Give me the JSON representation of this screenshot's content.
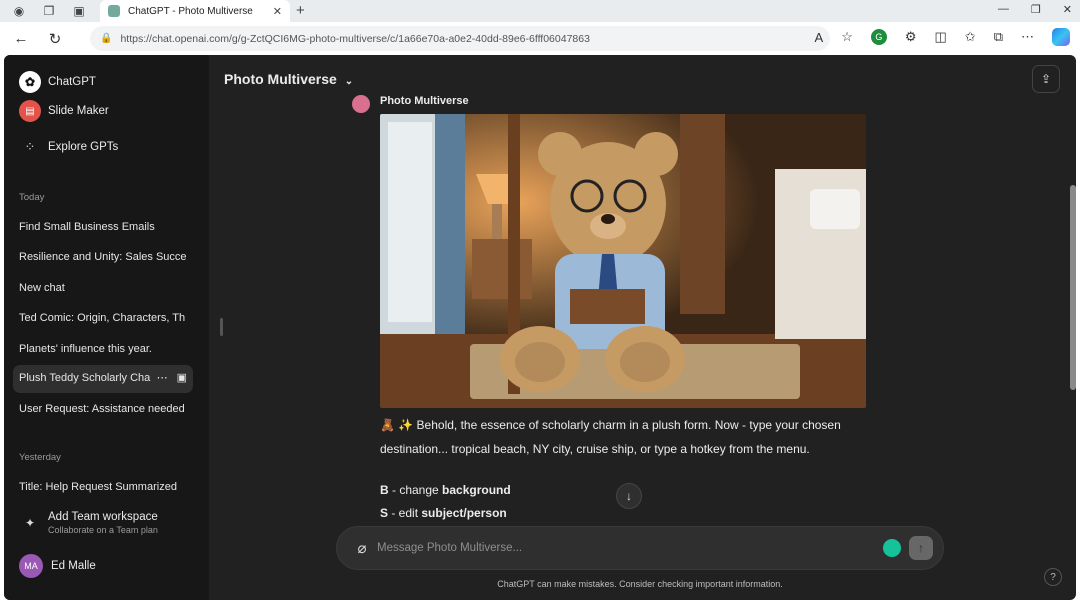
{
  "browser": {
    "tab_title": "ChatGPT - Photo Multiverse",
    "tab_close": "✕",
    "new_tab": "+",
    "url": "https://chat.openai.com/g/g-ZctQCI6MG-photo-multiverse/c/1a66e70a-a0e2-40dd-89e6-6fff06047863"
  },
  "sidebar": {
    "top_items": [
      {
        "label": "ChatGPT",
        "icon": "chatgpt-logo-icon"
      },
      {
        "label": "Slide Maker",
        "icon": "slide-maker-icon"
      },
      {
        "label": "Explore GPTs",
        "icon": "grid-icon"
      }
    ],
    "today_label": "Today",
    "today_chats": [
      "Find Small Business Emails",
      "Resilience and Unity: Sales Succe",
      "New chat",
      "Ted Comic: Origin, Characters, Th",
      "Planets' influence this year.",
      "Plush Teddy Scholarly Cha",
      "User Request: Assistance needed"
    ],
    "yesterday_label": "Yesterday",
    "yesterday_chats": [
      "Title: Help Request Summarized"
    ],
    "team": {
      "title": "Add Team workspace",
      "subtitle": "Collaborate on a Team plan"
    },
    "user": {
      "initials": "MA",
      "name": "Ed Malle"
    }
  },
  "main": {
    "title": "Photo Multiverse",
    "message": {
      "author": "Photo Multiverse",
      "line1": "🧸 ✨ Behold, the essence of scholarly charm in a plush form. Now - type your chosen",
      "line2": "destination... tropical beach, NY city, cruise ship, or type a hotkey from the menu.",
      "hotkeys": [
        {
          "key": "B",
          "sep": " - change ",
          "target": "background"
        },
        {
          "key": "S",
          "sep": " - edit ",
          "target": "subject/person"
        }
      ]
    },
    "composer": {
      "placeholder": "Message Photo Multiverse..."
    },
    "disclaimer": "ChatGPT can make mistakes. Consider checking important information.",
    "help": "?"
  },
  "colors": {
    "app_bg": "#212121",
    "sidebar_bg": "#171717",
    "text": "#ececec"
  }
}
